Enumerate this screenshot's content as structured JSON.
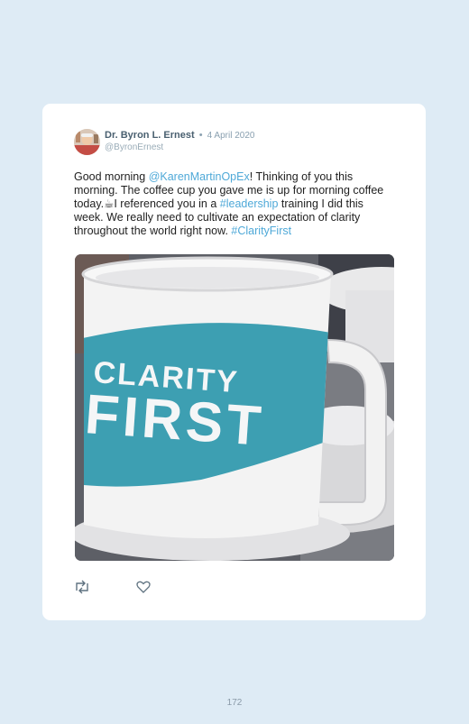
{
  "tweet": {
    "author_name": "Dr. Byron L. Ernest",
    "separator": "•",
    "date": "4 April 2020",
    "handle": "@ByronErnest",
    "text_parts": [
      "Good morning ",
      "@KarenMartinOpEx",
      "! Thinking of you this morning. The coffee cup you gave me is up for morning coffee today.",
      "☕",
      "I referenced you in a ",
      "#leadership",
      " training I did this week. We really need to cultivate an expectation of clarity throughout the world right now. ",
      "#ClarityFirst"
    ],
    "photo": {
      "mug_text_line1": "CLARITY",
      "mug_text_line2": "FIRST",
      "mug_color": "#3d9fb2"
    },
    "actions": {
      "retweet_icon": "retweet-icon",
      "like_icon": "heart-icon"
    }
  },
  "page": {
    "number": "172"
  },
  "colors": {
    "background": "#deebf5",
    "card": "#ffffff",
    "link": "#4fa9d8",
    "author": "#4a6070",
    "muted": "#8aa0b0"
  }
}
